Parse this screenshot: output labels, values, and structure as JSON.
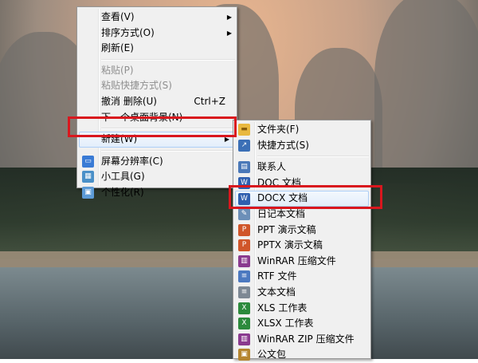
{
  "context_menu": {
    "items": [
      {
        "label": "查看(V)",
        "has_submenu": true,
        "enabled": true
      },
      {
        "label": "排序方式(O)",
        "has_submenu": true,
        "enabled": true
      },
      {
        "label": "刷新(E)",
        "enabled": true
      },
      {
        "label": "粘贴(P)",
        "enabled": false
      },
      {
        "label": "粘贴快捷方式(S)",
        "enabled": false
      },
      {
        "label": "撤消 删除(U)",
        "shortcut": "Ctrl+Z",
        "enabled": true
      },
      {
        "label": "下一个桌面背景(N)",
        "enabled": true
      },
      {
        "label": "新建(W)",
        "has_submenu": true,
        "enabled": true,
        "highlighted": true
      },
      {
        "label": "屏幕分辨率(C)",
        "icon": "screen-resolution-icon",
        "enabled": true
      },
      {
        "label": "小工具(G)",
        "icon": "gadgets-icon",
        "enabled": true
      },
      {
        "label": "个性化(R)",
        "icon": "personalize-icon",
        "enabled": true
      }
    ]
  },
  "new_submenu": {
    "items": [
      {
        "label": "文件夹(F)",
        "icon": "folder-icon",
        "color": "#e9b83f"
      },
      {
        "label": "快捷方式(S)",
        "icon": "shortcut-icon",
        "color": "#3b6fb6"
      },
      {
        "label": "联系人",
        "icon": "contact-icon",
        "color": "#4a78b8"
      },
      {
        "label": "DOC 文档",
        "icon": "doc-icon",
        "color": "#2f5faf"
      },
      {
        "label": "DOCX 文档",
        "icon": "docx-icon",
        "color": "#2f5faf",
        "highlighted": true
      },
      {
        "label": "日记本文档",
        "icon": "journal-icon",
        "color": "#6c8fb8"
      },
      {
        "label": "PPT 演示文稿",
        "icon": "ppt-icon",
        "color": "#d0562a"
      },
      {
        "label": "PPTX 演示文稿",
        "icon": "pptx-icon",
        "color": "#d0562a"
      },
      {
        "label": "WinRAR 压缩文件",
        "icon": "winrar-icon",
        "color": "#8a3a8f"
      },
      {
        "label": "RTF 文件",
        "icon": "rtf-icon",
        "color": "#4c79c0"
      },
      {
        "label": "文本文档",
        "icon": "text-icon",
        "color": "#7d8894"
      },
      {
        "label": "XLS 工作表",
        "icon": "xls-icon",
        "color": "#2c8a3c"
      },
      {
        "label": "XLSX 工作表",
        "icon": "xlsx-icon",
        "color": "#2c8a3c"
      },
      {
        "label": "WinRAR ZIP 压缩文件",
        "icon": "winrar-zip-icon",
        "color": "#8a3a8f"
      },
      {
        "label": "公文包",
        "icon": "briefcase-icon",
        "color": "#b5852f"
      }
    ]
  },
  "annotation": {
    "color": "#d9171e"
  }
}
